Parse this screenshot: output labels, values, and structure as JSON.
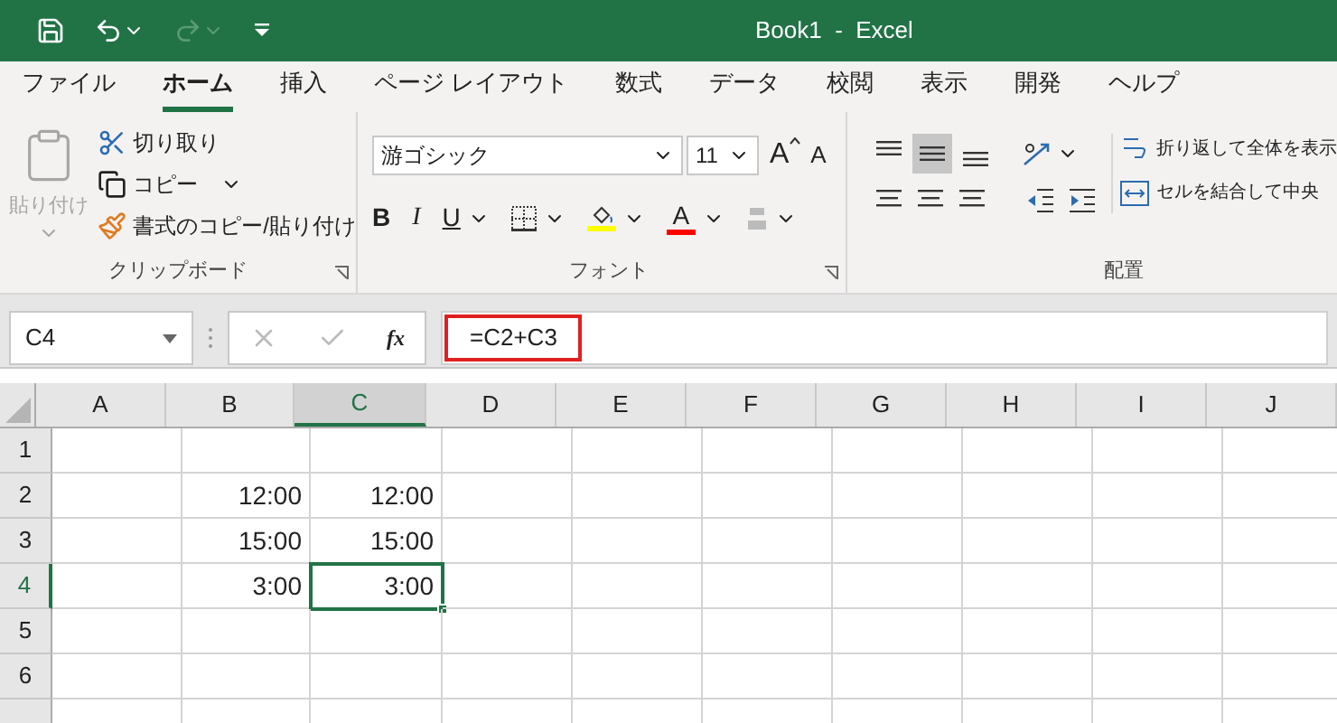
{
  "title_bar": {
    "title": "Book1  -  Excel",
    "quick_access": [
      {
        "kind": "save",
        "disabled": false
      },
      {
        "kind": "undo",
        "disabled": false
      },
      {
        "kind": "redo",
        "disabled": true
      },
      {
        "kind": "customize",
        "disabled": false
      }
    ]
  },
  "ribbon_tabs": [
    {
      "label": "ファイル",
      "selected": false
    },
    {
      "label": "ホーム",
      "selected": true
    },
    {
      "label": "挿入",
      "selected": false
    },
    {
      "label": "ページ レイアウト",
      "selected": false
    },
    {
      "label": "数式",
      "selected": false
    },
    {
      "label": "データ",
      "selected": false
    },
    {
      "label": "校閲",
      "selected": false
    },
    {
      "label": "表示",
      "selected": false
    },
    {
      "label": "開発",
      "selected": false
    },
    {
      "label": "ヘルプ",
      "selected": false
    }
  ],
  "clipboard": {
    "paste": {
      "label": "貼り付け",
      "disabled": true
    },
    "cut": "切り取り",
    "copy": "コピー",
    "format_painter": "書式のコピー/貼り付け",
    "group_label": "クリップボード"
  },
  "font": {
    "font_name": "游ゴシック",
    "font_size": "11",
    "grow": "A",
    "shrink": "A",
    "bold": "B",
    "italic": "I",
    "underline": "U",
    "font_color_letter": "A",
    "group_label": "フォント"
  },
  "alignment": {
    "vertical": [
      {
        "kind": "top",
        "selected": false
      },
      {
        "kind": "middle",
        "selected": true
      },
      {
        "kind": "bottom",
        "selected": false
      }
    ],
    "wrap_text": "折り返して全体を表示",
    "merge_center": "セルを結合して中央",
    "group_label": "配置"
  },
  "formula_bar": {
    "name_box": "C4",
    "function_label": "fx",
    "formula": "=C2+C3"
  },
  "grid": {
    "columns": [
      {
        "label": "A",
        "selected": false
      },
      {
        "label": "B",
        "selected": false
      },
      {
        "label": "C",
        "selected": true
      },
      {
        "label": "D",
        "selected": false
      },
      {
        "label": "E",
        "selected": false
      },
      {
        "label": "F",
        "selected": false
      },
      {
        "label": "G",
        "selected": false
      },
      {
        "label": "H",
        "selected": false
      },
      {
        "label": "I",
        "selected": false
      },
      {
        "label": "J",
        "selected": false
      }
    ],
    "rows": [
      {
        "label": "1",
        "selected": false,
        "cells": [
          null,
          null,
          null,
          null,
          null,
          null,
          null,
          null,
          null,
          null
        ]
      },
      {
        "label": "2",
        "selected": false,
        "cells": [
          null,
          "12:00",
          "12:00",
          null,
          null,
          null,
          null,
          null,
          null,
          null
        ]
      },
      {
        "label": "3",
        "selected": false,
        "cells": [
          null,
          "15:00",
          "15:00",
          null,
          null,
          null,
          null,
          null,
          null,
          null
        ]
      },
      {
        "label": "4",
        "selected": true,
        "cells": [
          null,
          "3:00",
          "3:00",
          null,
          null,
          null,
          null,
          null,
          null,
          null
        ]
      },
      {
        "label": "5",
        "selected": false,
        "cells": [
          null,
          null,
          null,
          null,
          null,
          null,
          null,
          null,
          null,
          null
        ]
      },
      {
        "label": "6",
        "selected": false,
        "cells": [
          null,
          null,
          null,
          null,
          null,
          null,
          null,
          null,
          null,
          null
        ]
      }
    ]
  }
}
